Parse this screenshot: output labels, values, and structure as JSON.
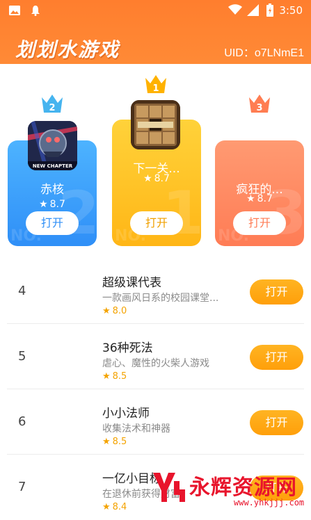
{
  "status_bar": {
    "time": "3:50",
    "icons": [
      "image-icon",
      "notification-icon",
      "wifi-icon",
      "signal-icon",
      "battery-charging-icon"
    ]
  },
  "header": {
    "title": "划划水游戏",
    "uid": "UID：o7LNmE1"
  },
  "podium": [
    {
      "rank": "2",
      "name": "赤核",
      "rating": "8.7",
      "button": "打开",
      "icon": "sphere-game-icon",
      "icon_caption": "NEW CHAPTER",
      "color": "#3aa0fb",
      "crown_color": "#42b5f0"
    },
    {
      "rank": "1",
      "name": "下一关...",
      "rating": "8.7",
      "button": "打开",
      "icon": "wooden-puzzle-icon",
      "color": "#ffc527",
      "crown_color": "#ffb400"
    },
    {
      "rank": "3",
      "name": "疯狂的...",
      "rating": "8.7",
      "button": "打开",
      "icon": "blank-game-icon",
      "color": "#ff8a62",
      "crown_color": "#ff7e54"
    }
  ],
  "list": [
    {
      "rank": "4",
      "name": "超级课代表",
      "desc": "一款画风日系的校园课堂...",
      "rating": "8.0",
      "button": "打开"
    },
    {
      "rank": "5",
      "name": "36种死法",
      "desc": "虐心、魔性的火柴人游戏",
      "rating": "8.5",
      "button": "打开"
    },
    {
      "rank": "6",
      "name": "小小法师",
      "desc": "收集法术和神器",
      "rating": "8.5",
      "button": "打开"
    },
    {
      "rank": "7",
      "name": "一亿小目标",
      "desc": "在退休前获得财富",
      "rating": "8.4",
      "button": "打开"
    }
  ],
  "watermark": {
    "text": "永辉资源网",
    "url": "www.yhkjjj.com"
  }
}
